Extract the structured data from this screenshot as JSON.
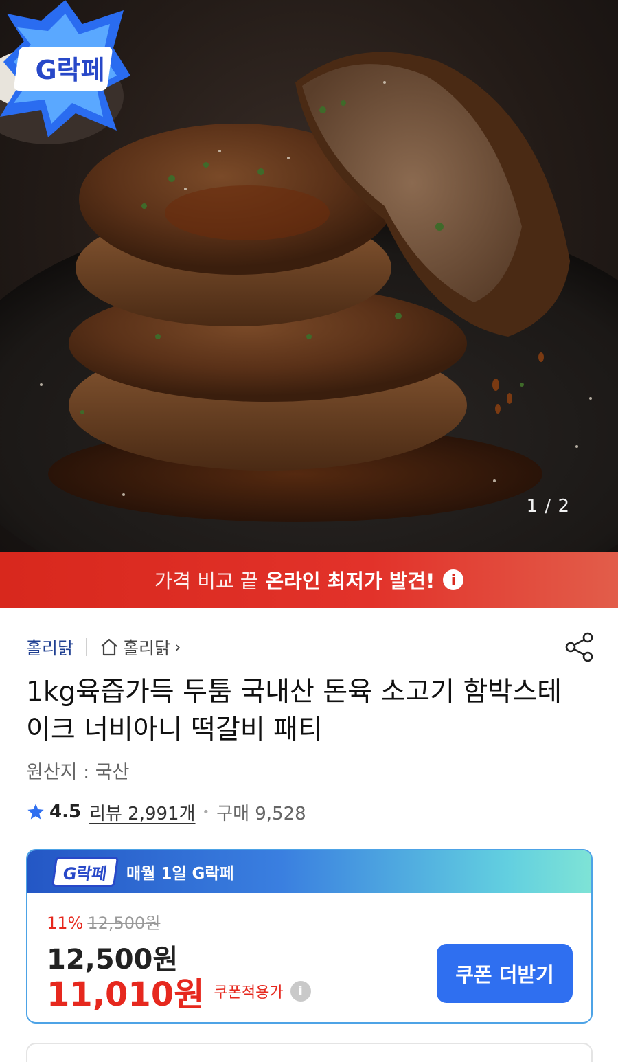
{
  "hero": {
    "counter": "1 / 2",
    "badge_text": "G락페"
  },
  "banner": {
    "text_light": "가격 비교 끝",
    "text_bold": "온라인 최저가 발견!",
    "info_symbol": "i"
  },
  "seller": {
    "name": "홀리닭",
    "store_name": "홀리닭",
    "store_chevron": "›"
  },
  "product": {
    "title": "1kg육즙가득 두툼 국내산 돈육 소고기 함박스테이크 너비아니 떡갈비 패티",
    "origin": "원산지 : 국산",
    "rating": "4.5",
    "reviews": "리뷰 2,991개",
    "purchases": "구매 9,528"
  },
  "coupon_card": {
    "badge_text": "G락페",
    "header_label": "매월 1일 G락페",
    "discount_pct": "11%",
    "original_price": "12,500원",
    "price": "12,500원",
    "sale_price": "11,010원",
    "sale_note": "쿠폰적용가",
    "info_symbol": "i",
    "button_label": "쿠폰 더받기"
  },
  "colors": {
    "accent_red": "#e6281e",
    "accent_blue": "#2f6ff0",
    "banner_red": "#d8281d",
    "seller_blue": "#1f3f91"
  }
}
